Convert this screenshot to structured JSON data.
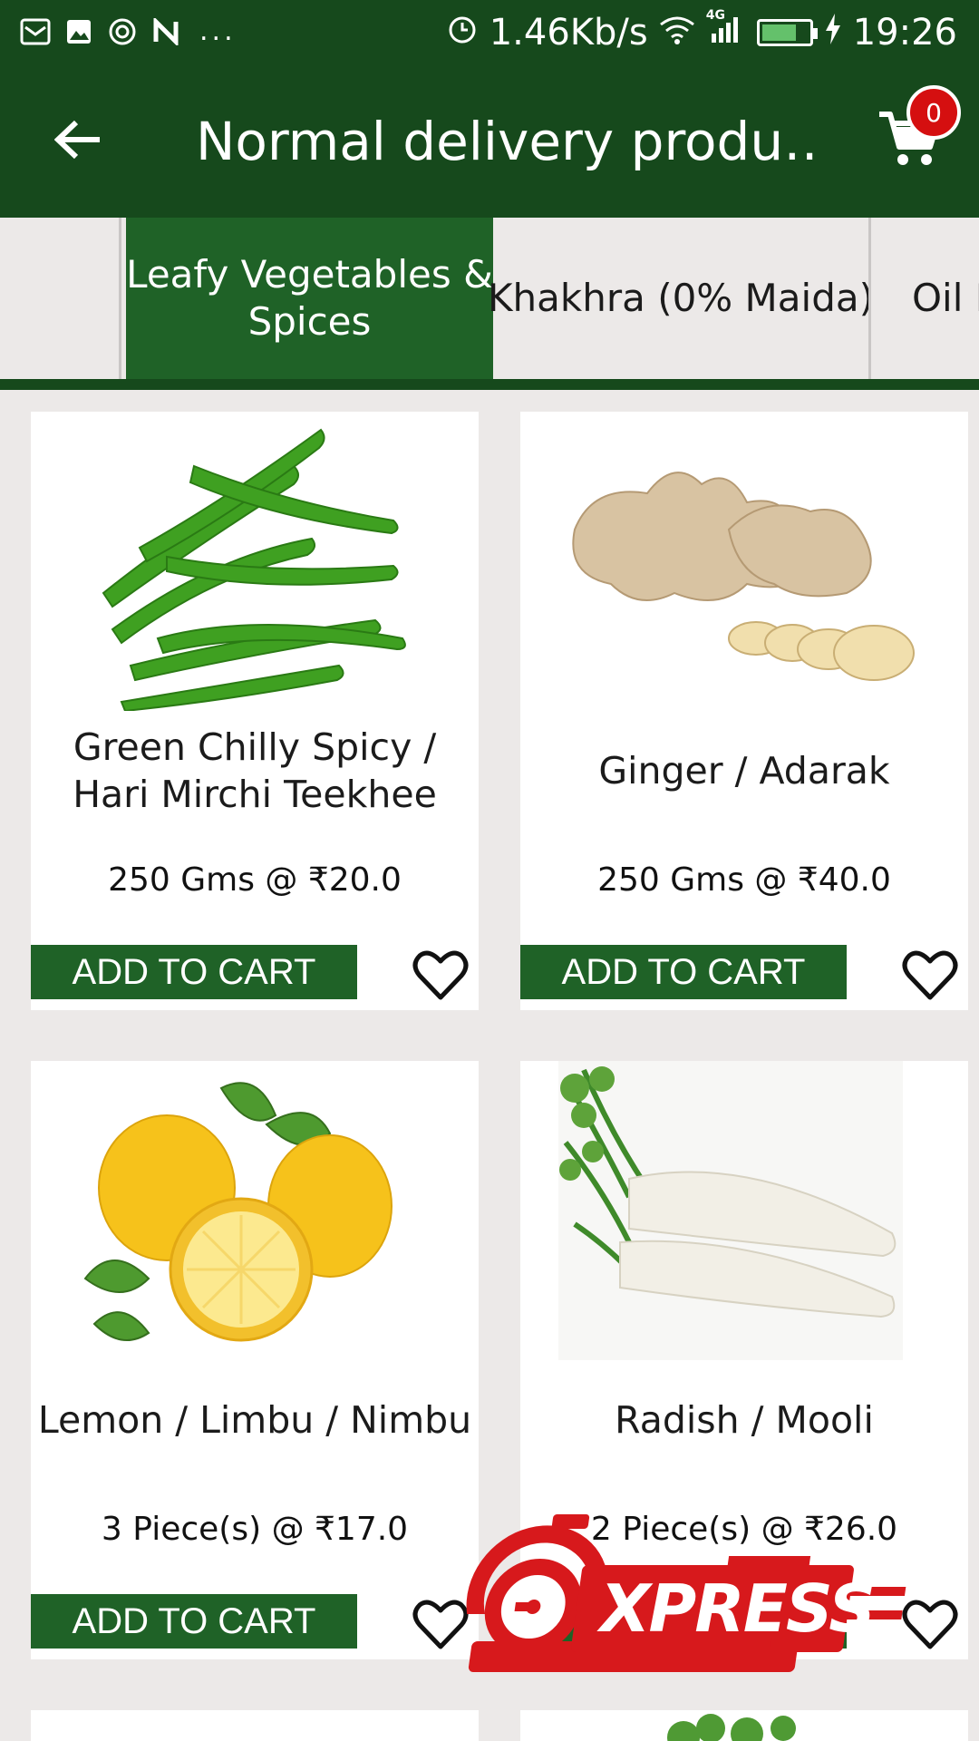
{
  "status_bar": {
    "speed": "1.46Kb/s",
    "network": "4G",
    "time": "19:26",
    "battery_level": 0.75,
    "dots": "..."
  },
  "app_bar": {
    "title": "Normal delivery produ…",
    "cart_count": "0"
  },
  "tabs": [
    {
      "label": ""
    },
    {
      "label": "Leafy Vegetables &\nSpices",
      "active": true
    },
    {
      "label": "Khakhra (0% Maida)"
    },
    {
      "label": "Oil F"
    }
  ],
  "products": [
    {
      "name": "Green Chilly Spicy / Hari Mirchi Teekhee",
      "price": "250 Gms @ ₹20.0",
      "button": "ADD TO CART",
      "image": "green-chilli-image"
    },
    {
      "name": "Ginger / Adarak",
      "price": "250 Gms @ ₹40.0",
      "button": "ADD TO CART",
      "image": "ginger-image"
    },
    {
      "name": "Lemon / Limbu / Nimbu",
      "price": "3 Piece(s) @ ₹17.0",
      "button": "ADD TO CART",
      "image": "lemon-image"
    },
    {
      "name": "Radish / Mooli",
      "price": "2 Piece(s) @ ₹26.0",
      "button": "",
      "image": "radish-image"
    }
  ],
  "overlay": {
    "express_text": "XPRESS"
  },
  "colors": {
    "primary_dark": "#16491c",
    "primary": "#1f6227",
    "badge_red": "#d50f10",
    "background": "#ece9e8"
  }
}
